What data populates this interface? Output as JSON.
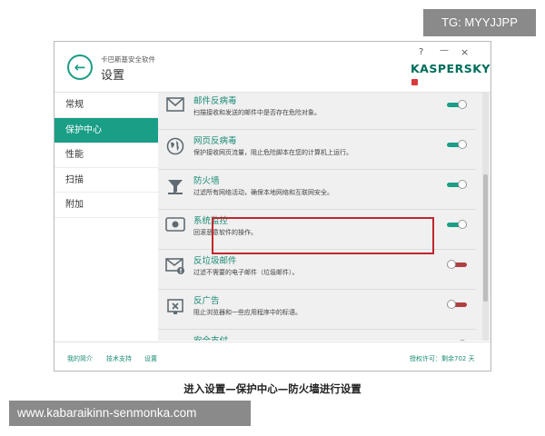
{
  "watermarks": {
    "top": "TG: MYYJJPP",
    "bottom": "www.kabaraikinn-senmonka.com"
  },
  "window": {
    "app_name": "卡巴斯基安全软件",
    "page_title": "设置",
    "help_label": "?",
    "minimize_label": "—",
    "close_label": "×",
    "logo_text": "KASPERSKY",
    "back_icon": "arrow-left-icon"
  },
  "sidebar": {
    "items": [
      {
        "label": "常规",
        "active": false
      },
      {
        "label": "保护中心",
        "active": true
      },
      {
        "label": "性能",
        "active": false
      },
      {
        "label": "扫描",
        "active": false
      },
      {
        "label": "附加",
        "active": false
      }
    ]
  },
  "components": [
    {
      "title": "邮件反病毒",
      "desc": "扫描接收和发送的邮件中是否存在危险对象。",
      "icon": "mail-icon",
      "enabled": true
    },
    {
      "title": "网页反病毒",
      "desc": "保护接收网页流量，阻止危险脚本在您的计算机上运行。",
      "icon": "globe-icon",
      "enabled": true
    },
    {
      "title": "防火墙",
      "desc": "过滤所有网络活动，确保本地网络和互联网安全。",
      "icon": "funnel-icon",
      "enabled": true
    },
    {
      "title": "系统监控",
      "desc": "回滚恶意软件的操作。",
      "icon": "eye-icon",
      "enabled": true
    },
    {
      "title": "反垃圾邮件",
      "desc": "过滤不需要的电子邮件（垃圾邮件）。",
      "icon": "spam-mail-icon",
      "enabled": false
    },
    {
      "title": "反广告",
      "desc": "阻止浏览器和一些应用程序中的标语。",
      "icon": "ad-block-icon",
      "enabled": false
    },
    {
      "title": "安全支付",
      "desc": "",
      "icon": "payment-icon",
      "enabled": true
    }
  ],
  "footer": {
    "links": [
      "我的简介",
      "技术支持",
      "设置"
    ],
    "license": "授权许可：剩余702 天"
  },
  "caption": "进入设置—保护中心—防火墙进行设置",
  "colors": {
    "accent": "#1a9e86",
    "highlight": "#c0272d",
    "toggle_off": "#b04040"
  }
}
